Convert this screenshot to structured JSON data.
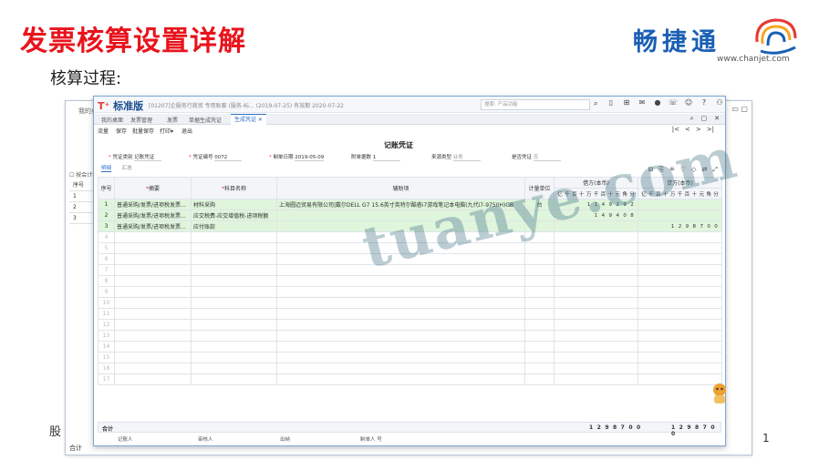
{
  "slide": {
    "title": "发票核算设置详解",
    "subtitle": "核算过程:",
    "page_number": "1",
    "stub_text": "股",
    "logo": {
      "name": "畅捷通",
      "url": "www.chanjet.com"
    }
  },
  "background_window": {
    "tab": "我的桌",
    "checkbox_label": "按会计科",
    "row_label_header": "序号",
    "rows": [
      "1",
      "2",
      "3"
    ],
    "total_label": "合计"
  },
  "app": {
    "brand": "标准版",
    "brand_prefix": "T",
    "info": "[01207]企服务行商贸 专用账套 (服务-标... (2019-07-25) 有效期 2020-07-22",
    "search_placeholder": "搜索: 产品功能",
    "tabs": [
      "我的桌面",
      "发票管理",
      "发票",
      "单据生成凭证",
      "生成凭证"
    ],
    "active_tab": "生成凭证",
    "toolbar": [
      "流量",
      "保存",
      "批量保存",
      "打印▾",
      "退出"
    ]
  },
  "voucher": {
    "title": "记账凭证",
    "fields": {
      "type_label": "凭证类别",
      "type_value": "记账凭证",
      "no_label": "凭证编号",
      "no_value": "0072",
      "date_label": "制单日期",
      "date_value": "2019-05-09",
      "attach_label": "附单据数",
      "attach_value": "1",
      "source_label": "来源类型",
      "source_value": "业务",
      "status_label": "是否凭证",
      "status_value": "否"
    },
    "subtabs": [
      "明细",
      "汇总"
    ],
    "columns": {
      "seq": "序号",
      "summary": "摘要",
      "account": "科目名称",
      "aux": "辅助项",
      "unit": "计量单位",
      "debit": "借方(本币)",
      "credit": "贷方(本币)",
      "digits": [
        "亿",
        "千",
        "百",
        "十",
        "万",
        "千",
        "百",
        "十",
        "元",
        "角",
        "分"
      ]
    },
    "rows": [
      {
        "seq": "1",
        "summary": "普通采购/发票/进项税发票...",
        "account": "材料采购",
        "aux": "上海圆迈贸易有限公司|戴尔DELL G7 15.6英寸英特尔酷睿i7游戏笔记本电脑(九代i7-9750H)GB",
        "unit": "台",
        "debit": "1149292",
        "credit": ""
      },
      {
        "seq": "2",
        "summary": "普通采购/发票/进项税发票...",
        "account": "应交税费-应交增值税-进项税额",
        "aux": "",
        "unit": "",
        "debit": "149408",
        "credit": ""
      },
      {
        "seq": "3",
        "summary": "普通采购/发票/进项税发票...",
        "account": "应付账款",
        "aux": "",
        "unit": "",
        "debit": "",
        "credit": "1298700"
      }
    ],
    "empty_rows": [
      "4",
      "5",
      "6",
      "7",
      "8",
      "9",
      "10",
      "11",
      "12",
      "13",
      "14",
      "15",
      "16",
      "17"
    ],
    "total_label": "合计",
    "total_debit": "1298700",
    "total_credit": "1298700",
    "sign": {
      "bookkeeper": "记账人",
      "reviewer": "审核人",
      "cashier": "出纳",
      "maker": "制单人 号"
    }
  },
  "watermark": "tuanye.com"
}
